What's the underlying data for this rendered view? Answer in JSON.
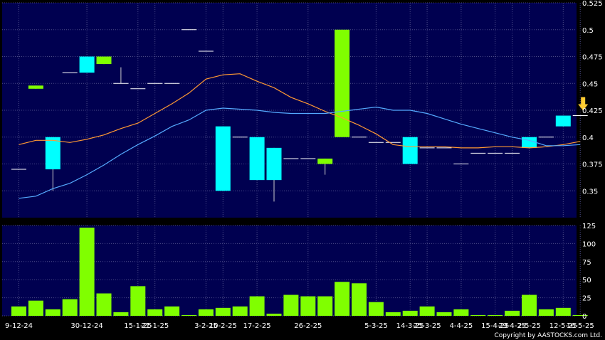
{
  "chart_data": [
    {
      "type": "candlestick",
      "panel": "price",
      "ylim": [
        0.325,
        0.525
      ],
      "yticks": [
        0.35,
        0.375,
        0.4,
        0.425,
        0.45,
        0.475,
        0.5,
        0.525
      ],
      "ytick_labels": [
        "0.35",
        "0.375",
        "0.4",
        "0.425",
        "0.45",
        "0.475",
        "0.5",
        "0.525"
      ],
      "grid": true,
      "colors": {
        "background": "#000050",
        "grid": "#4a4a8a",
        "up": "#80ff00",
        "down": "#00ffff",
        "flat": "#ffffff",
        "ma_short": "#ff9933",
        "ma_long": "#55aaff",
        "arrow": "#ffcc33"
      },
      "candles": [
        {
          "o": 0.37,
          "h": 0.37,
          "l": 0.37,
          "c": 0.37
        },
        {
          "o": 0.445,
          "h": 0.448,
          "l": 0.445,
          "c": 0.448
        },
        {
          "o": 0.4,
          "h": 0.4,
          "l": 0.35,
          "c": 0.37
        },
        {
          "o": 0.46,
          "h": 0.46,
          "l": 0.46,
          "c": 0.46
        },
        {
          "o": 0.475,
          "h": 0.475,
          "l": 0.46,
          "c": 0.46
        },
        {
          "o": 0.468,
          "h": 0.475,
          "l": 0.468,
          "c": 0.475
        },
        {
          "o": 0.45,
          "h": 0.465,
          "l": 0.45,
          "c": 0.45
        },
        {
          "o": 0.445,
          "h": 0.445,
          "l": 0.445,
          "c": 0.445
        },
        {
          "o": 0.45,
          "h": 0.45,
          "l": 0.45,
          "c": 0.45
        },
        {
          "o": 0.45,
          "h": 0.45,
          "l": 0.45,
          "c": 0.45
        },
        {
          "o": 0.5,
          "h": 0.5,
          "l": 0.5,
          "c": 0.5
        },
        {
          "o": 0.48,
          "h": 0.48,
          "l": 0.48,
          "c": 0.48
        },
        {
          "o": 0.41,
          "h": 0.41,
          "l": 0.35,
          "c": 0.35
        },
        {
          "o": 0.4,
          "h": 0.4,
          "l": 0.4,
          "c": 0.4
        },
        {
          "o": 0.4,
          "h": 0.4,
          "l": 0.36,
          "c": 0.36
        },
        {
          "o": 0.39,
          "h": 0.39,
          "l": 0.34,
          "c": 0.36
        },
        {
          "o": 0.38,
          "h": 0.38,
          "l": 0.38,
          "c": 0.38
        },
        {
          "o": 0.38,
          "h": 0.38,
          "l": 0.38,
          "c": 0.38
        },
        {
          "o": 0.375,
          "h": 0.38,
          "l": 0.365,
          "c": 0.38
        },
        {
          "o": 0.4,
          "h": 0.5,
          "l": 0.4,
          "c": 0.5
        },
        {
          "o": 0.4,
          "h": 0.4,
          "l": 0.4,
          "c": 0.4
        },
        {
          "o": 0.395,
          "h": 0.395,
          "l": 0.395,
          "c": 0.395
        },
        {
          "o": 0.395,
          "h": 0.395,
          "l": 0.395,
          "c": 0.395
        },
        {
          "o": 0.4,
          "h": 0.4,
          "l": 0.375,
          "c": 0.375
        },
        {
          "o": 0.39,
          "h": 0.39,
          "l": 0.39,
          "c": 0.39
        },
        {
          "o": 0.39,
          "h": 0.39,
          "l": 0.39,
          "c": 0.39
        },
        {
          "o": 0.375,
          "h": 0.375,
          "l": 0.375,
          "c": 0.375
        },
        {
          "o": 0.385,
          "h": 0.385,
          "l": 0.385,
          "c": 0.385
        },
        {
          "o": 0.385,
          "h": 0.385,
          "l": 0.385,
          "c": 0.385
        },
        {
          "o": 0.385,
          "h": 0.385,
          "l": 0.385,
          "c": 0.385
        },
        {
          "o": 0.4,
          "h": 0.4,
          "l": 0.39,
          "c": 0.39
        },
        {
          "o": 0.4,
          "h": 0.4,
          "l": 0.4,
          "c": 0.4
        },
        {
          "o": 0.42,
          "h": 0.42,
          "l": 0.41,
          "c": 0.41
        },
        {
          "o": 0.42,
          "h": 0.42,
          "l": 0.42,
          "c": 0.42
        }
      ],
      "series": [
        {
          "values": [
            0.393,
            0.397,
            0.397,
            0.395,
            0.398,
            0.402,
            0.408,
            0.413,
            0.422,
            0.431,
            0.441,
            0.454,
            0.458,
            0.459,
            0.452,
            0.446,
            0.437,
            0.431,
            0.424,
            0.418,
            0.411,
            0.403,
            0.393,
            0.391,
            0.391,
            0.391,
            0.39,
            0.39,
            0.391,
            0.391,
            0.39,
            0.391,
            0.393,
            0.396
          ]
        },
        {
          "values": [
            0.343,
            0.345,
            0.352,
            0.357,
            0.365,
            0.374,
            0.384,
            0.393,
            0.401,
            0.41,
            0.416,
            0.425,
            0.427,
            0.426,
            0.425,
            0.423,
            0.422,
            0.422,
            0.422,
            0.424,
            0.426,
            0.428,
            0.425,
            0.425,
            0.422,
            0.417,
            0.412,
            0.408,
            0.404,
            0.4,
            0.397,
            0.392,
            0.392,
            0.393
          ]
        }
      ],
      "annotation": {
        "type": "arrow-down",
        "index": 33,
        "value": 0.42
      }
    },
    {
      "type": "bar",
      "panel": "volume",
      "ylim": [
        0,
        125
      ],
      "yticks": [
        0,
        25,
        50,
        75,
        100,
        125
      ],
      "ytick_labels": [
        "0",
        "25",
        "50",
        "75",
        "100",
        "125"
      ],
      "values": [
        13,
        21,
        9,
        23,
        122,
        31,
        5,
        41,
        9,
        13,
        1,
        9,
        11,
        13,
        27,
        3,
        29,
        27,
        27,
        47,
        45,
        19,
        5,
        7,
        13,
        5,
        9,
        1,
        1,
        7,
        29,
        9,
        11,
        1,
        0,
        0
      ],
      "x_labels": [
        {
          "index": 0,
          "text": "9-12-24"
        },
        {
          "index": 4,
          "text": "30-12-24"
        },
        {
          "index": 7,
          "text": "15-1-25"
        },
        {
          "index": 8,
          "text": "21-1-25"
        },
        {
          "index": 11,
          "text": "3-2-25"
        },
        {
          "index": 12,
          "text": "10-2-25"
        },
        {
          "index": 14,
          "text": "17-2-25"
        },
        {
          "index": 17,
          "text": "26-2-25"
        },
        {
          "index": 21,
          "text": "5-3-25"
        },
        {
          "index": 23,
          "text": "14-3-25"
        },
        {
          "index": 24,
          "text": "25-3-25"
        },
        {
          "index": 26,
          "text": "4-4-25"
        },
        {
          "index": 28,
          "text": "15-4-25"
        },
        {
          "index": 29,
          "text": "29-4-25"
        },
        {
          "index": 30,
          "text": "2-5-25"
        },
        {
          "index": 32,
          "text": "12-5-25"
        },
        {
          "index": 33,
          "text": "16-5-25"
        }
      ]
    }
  ],
  "footer": {
    "copyright": "Copyright by AASTOCKS.com Ltd."
  }
}
